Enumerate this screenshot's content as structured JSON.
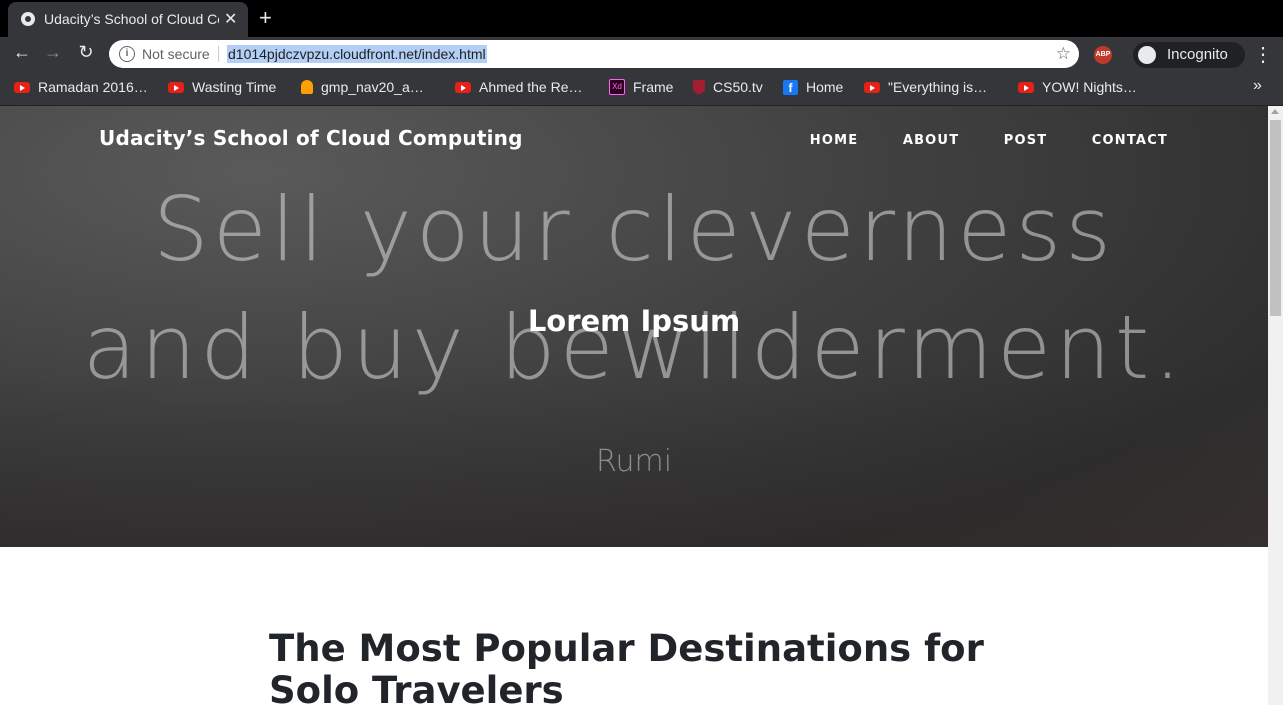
{
  "browser": {
    "tab_title": "Udacity’s School of Cloud Computing",
    "tab_close": "✕",
    "new_tab": "+",
    "not_secure": "Not secure",
    "url": "d1014pjdczvpzu.cloudfront.net/index.html",
    "abp_label": "ABP",
    "incognito_label": "Incognito",
    "bookmarks": [
      {
        "label": "Ramadan 2016…",
        "icon": "youtube-icon"
      },
      {
        "label": "Wasting Time",
        "icon": "youtube-icon"
      },
      {
        "label": "gmp_nav20_a…",
        "icon": "firebase-icon"
      },
      {
        "label": "Ahmed the Re…",
        "icon": "youtube-icon"
      },
      {
        "label": "Frame",
        "icon": "adobe-xd-icon"
      },
      {
        "label": "CS50.tv",
        "icon": "harvard-icon"
      },
      {
        "label": "Home",
        "icon": "facebook-icon"
      },
      {
        "label": "\"Everything is…",
        "icon": "youtube-icon"
      },
      {
        "label": "YOW! Nights…",
        "icon": "youtube-icon"
      }
    ],
    "bookmarks_more": "»"
  },
  "site": {
    "brand": "Udacity’s School of Cloud Computing",
    "nav": [
      "HOME",
      "ABOUT",
      "POST",
      "CONTACT"
    ],
    "hero": {
      "quote_line1": "Sell your cleverness",
      "quote_line2": "and buy bewilderment.",
      "quote_author": "Rumi",
      "title": "Lorem Ipsum"
    },
    "article_title": "The Most Popular Destinations for Solo Travelers"
  },
  "colors": {
    "chrome_dark": "#35363a",
    "tabbar": "#000000",
    "url_highlight": "#b3cff5",
    "hero_bg": "#404040"
  }
}
